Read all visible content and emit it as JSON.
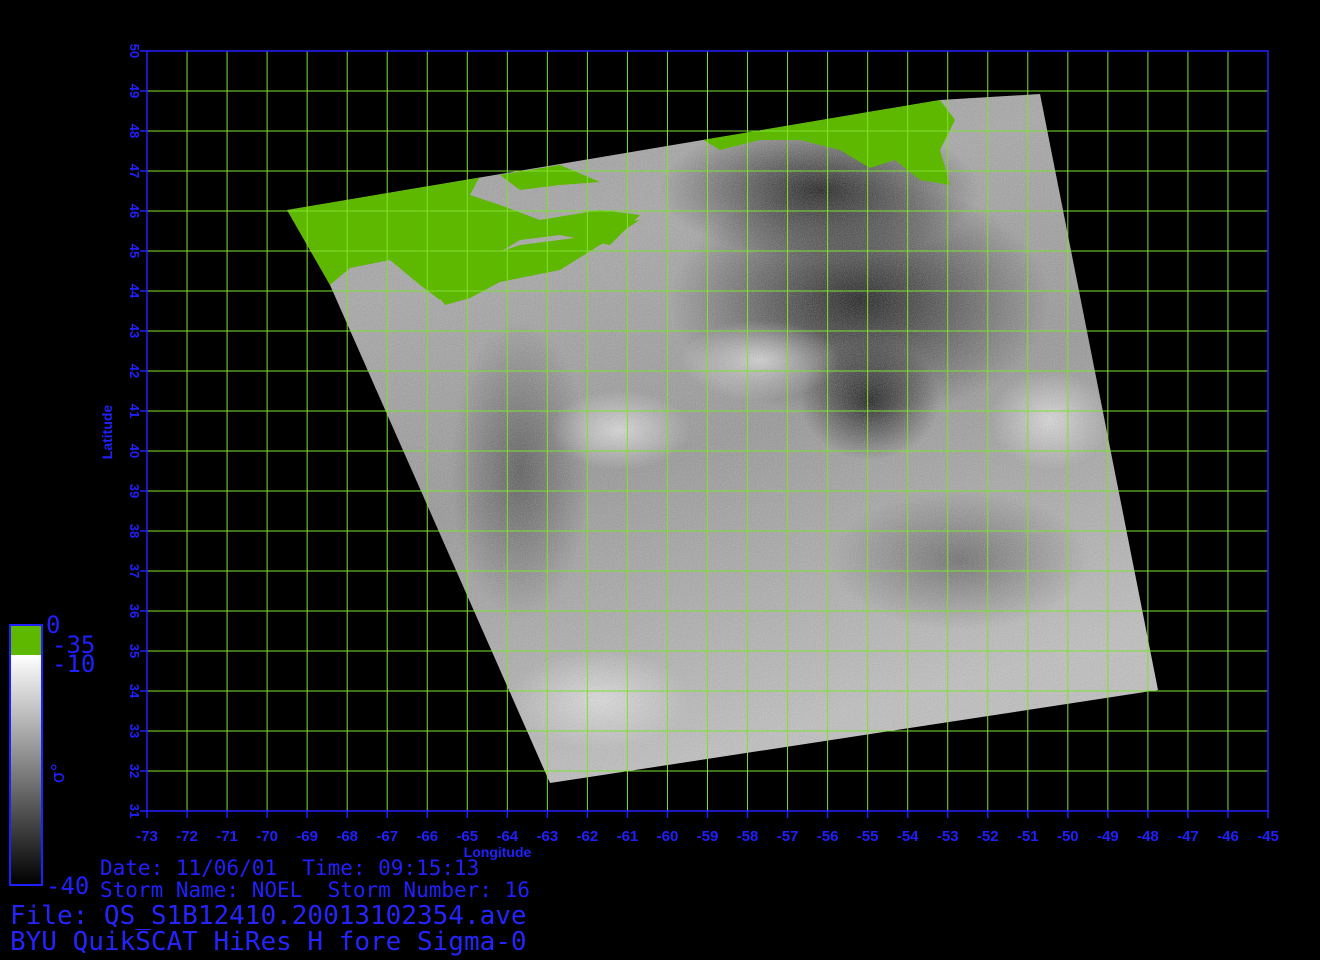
{
  "map": {
    "lon_range": [
      -73,
      -45
    ],
    "lat_range": [
      31,
      50
    ],
    "lon_ticks": [
      "-73",
      "-72",
      "-71",
      "-70",
      "-69",
      "-68",
      "-67",
      "-66",
      "-65",
      "-64",
      "-63",
      "-62",
      "-61",
      "-60",
      "-59",
      "-58",
      "-57",
      "-56",
      "-55",
      "-54",
      "-53",
      "-52",
      "-51",
      "-50",
      "-49",
      "-48",
      "-47",
      "-46",
      "-45"
    ],
    "lat_ticks": [
      "31",
      "32",
      "33",
      "34",
      "35",
      "36",
      "37",
      "38",
      "39",
      "40",
      "41",
      "42",
      "43",
      "44",
      "45",
      "46",
      "47",
      "48",
      "49",
      "50"
    ],
    "xlabel": "Longitude",
    "ylabel": "Latitude",
    "grid": true,
    "colors": {
      "axis": "#2020ff",
      "grid": "#7fe030",
      "land": "#5fb800",
      "background": "#000000"
    }
  },
  "colorbar": {
    "labels": [
      "0",
      "-35",
      "-10",
      "-40"
    ],
    "symbol": "σ°"
  },
  "info": {
    "date_line": "Date: 11/06/01  Time: 09:15:13",
    "storm_line": "Storm Name: NOEL  Storm Number: 16",
    "file_line": "File: QS_S1B12410.20013102354.ave",
    "product_line": "BYU QuikSCAT HiRes H fore Sigma-0"
  }
}
